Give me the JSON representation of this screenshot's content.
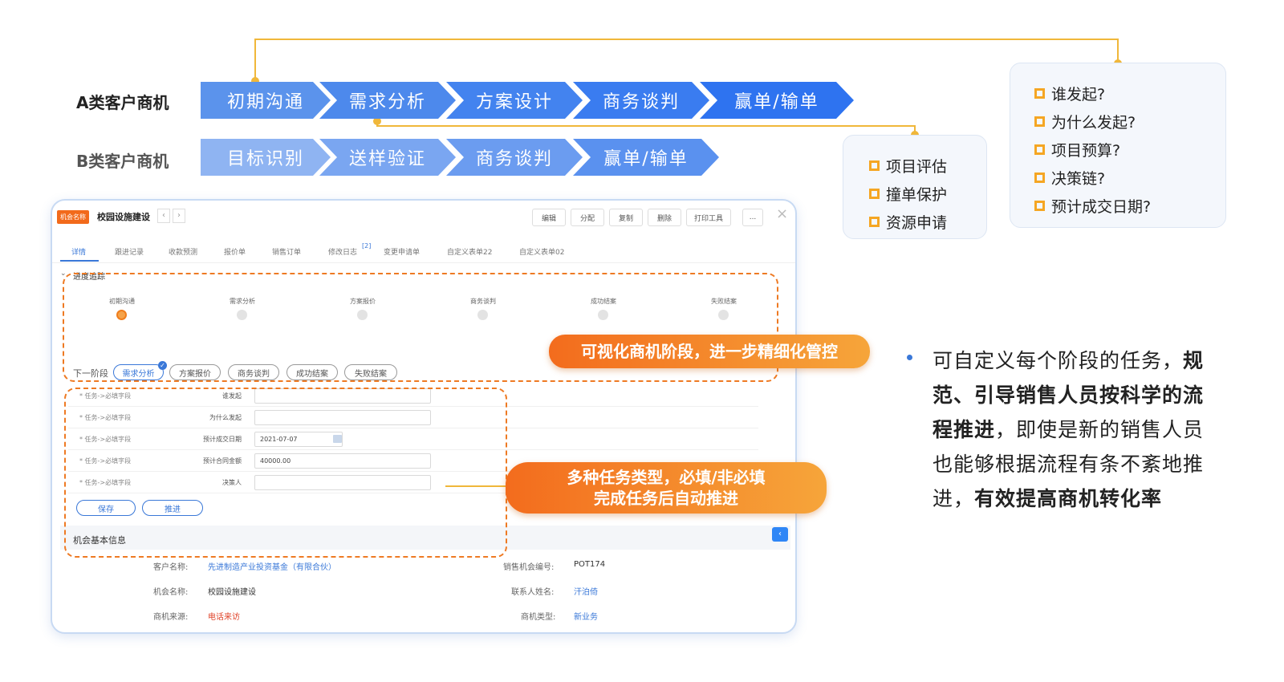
{
  "pipeline": {
    "row_a": {
      "label": "A类客户商机",
      "stages": [
        "初期沟通",
        "需求分析",
        "方案设计",
        "商务谈判",
        "赢单/输单"
      ]
    },
    "row_b": {
      "label": "B类客户商机",
      "stages": [
        "目标识别",
        "送样验证",
        "商务谈判",
        "赢单/输单"
      ]
    }
  },
  "mid_box": {
    "items": [
      "项目评估",
      "撞单保护",
      "资源申请"
    ]
  },
  "right_box": {
    "items": [
      "谁发起?",
      "为什么发起?",
      "项目预算?",
      "决策链?",
      "预计成交日期?"
    ]
  },
  "app": {
    "badge": "机会名称",
    "title": "校园设施建设",
    "toolbar": [
      "编辑",
      "分配",
      "复制",
      "删除",
      "打印工具",
      "..."
    ],
    "tabs": [
      "详情",
      "跟进记录",
      "收款预测",
      "报价单",
      "销售订单",
      "修改日志",
      "变更申请单",
      "自定义表单22",
      "自定义表单02"
    ],
    "tab_badge": "[2]",
    "section_progress": "进度追踪",
    "stages": [
      "初期沟通",
      "需求分析",
      "方案报价",
      "商务谈判",
      "成功结案",
      "失败结案"
    ],
    "next_label": "下一阶段",
    "next_options": [
      "需求分析",
      "方案报价",
      "商务谈判",
      "成功结案",
      "失败结案"
    ],
    "task_rows": [
      {
        "req": "* 任务->必填字段",
        "label": "谁发起",
        "value": ""
      },
      {
        "req": "* 任务->必填字段",
        "label": "为什么发起",
        "value": ""
      },
      {
        "req": "* 任务->必填字段",
        "label": "预计成交日期",
        "value": "2021-07-07"
      },
      {
        "req": "* 任务->必填字段",
        "label": "预计合同金额",
        "value": "40000.00"
      },
      {
        "req": "* 任务->必填字段",
        "label": "决策人",
        "value": ""
      }
    ],
    "save_label": "保存",
    "advance_label": "推进",
    "section_basic": "机会基本信息",
    "info": {
      "customer_label": "客户名称:",
      "customer_value": "先进制造产业投资基金（有限合伙）",
      "opp_no_label": "销售机会编号:",
      "opp_no_value": "POT174",
      "opp_name_label": "机会名称:",
      "opp_name_value": "校园设施建设",
      "contact_label": "联系人姓名:",
      "contact_value": "汗泊倚",
      "source_label": "商机来源:",
      "source_value": "电话来访",
      "type_label": "商机类型:",
      "type_value": "新业务"
    }
  },
  "callouts": {
    "stage": "可视化商机阶段，进一步精细化管控",
    "task_line1": "多种任务类型，必填/非必填",
    "task_line2": "完成任务后自动推进"
  },
  "description": {
    "p1": "可自定义每个阶段的任务，",
    "b1": "规范、引导销售人员按科学的流程推进",
    "p2": "，即使是新的销售人员也能够根据流程有条不紊地推进，",
    "b2": "有效提高商机转化率"
  },
  "colors": {
    "accent_blue": "#3d7ff0",
    "accent_orange": "#f36c1d",
    "connector": "#f0b73a"
  }
}
